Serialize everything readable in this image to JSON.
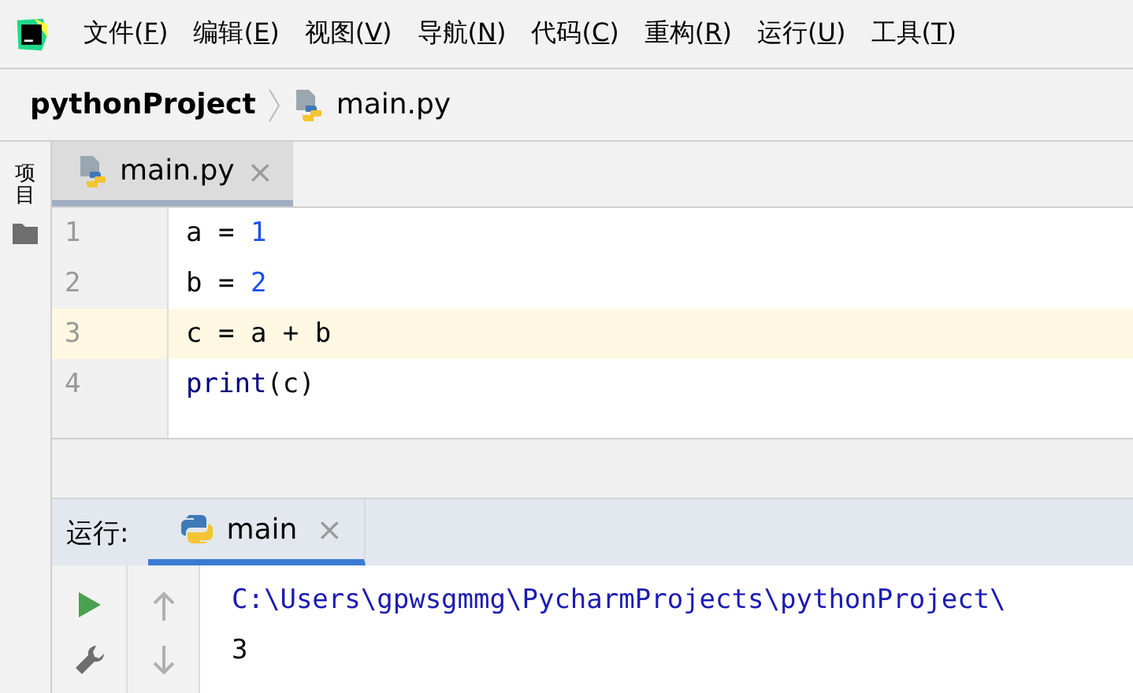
{
  "menu": [
    {
      "prefix": "文件(",
      "key": "F",
      "suffix": ")"
    },
    {
      "prefix": "编辑(",
      "key": "E",
      "suffix": ")"
    },
    {
      "prefix": "视图(",
      "key": "V",
      "suffix": ")"
    },
    {
      "prefix": "导航(",
      "key": "N",
      "suffix": ")"
    },
    {
      "prefix": "代码(",
      "key": "C",
      "suffix": ")"
    },
    {
      "prefix": "重构(",
      "key": "R",
      "suffix": ")"
    },
    {
      "prefix": "运行(",
      "key": "U",
      "suffix": ")"
    },
    {
      "prefix": "工具(",
      "key": "T",
      "suffix": ")"
    }
  ],
  "breadcrumb": {
    "project": "pythonProject",
    "file": "main.py"
  },
  "side_tool": {
    "label": "项目"
  },
  "editor_tabs": [
    {
      "label": "main.py",
      "selected": true,
      "close": "×"
    }
  ],
  "code": [
    {
      "number": "1",
      "current": false,
      "tokens": [
        {
          "text": "a = ",
          "kind": "plain"
        },
        {
          "text": "1",
          "kind": "number"
        }
      ]
    },
    {
      "number": "2",
      "current": false,
      "tokens": [
        {
          "text": "b = ",
          "kind": "plain"
        },
        {
          "text": "2",
          "kind": "number"
        }
      ]
    },
    {
      "number": "3",
      "current": true,
      "tokens": [
        {
          "text": "c = a + b",
          "kind": "plain"
        }
      ]
    },
    {
      "number": "4",
      "current": false,
      "tokens": [
        {
          "text": "print",
          "kind": "builtin"
        },
        {
          "text": "(c)",
          "kind": "plain"
        }
      ]
    }
  ],
  "run_panel": {
    "label": "运行:",
    "tabs": [
      {
        "label": "main",
        "selected": true,
        "close": "×"
      }
    ],
    "output": [
      {
        "text": "C:\\Users\\gpwsgmmg\\PycharmProjects\\pythonProject\\",
        "kind": "command"
      },
      {
        "text": "3",
        "kind": "stdout"
      }
    ]
  }
}
